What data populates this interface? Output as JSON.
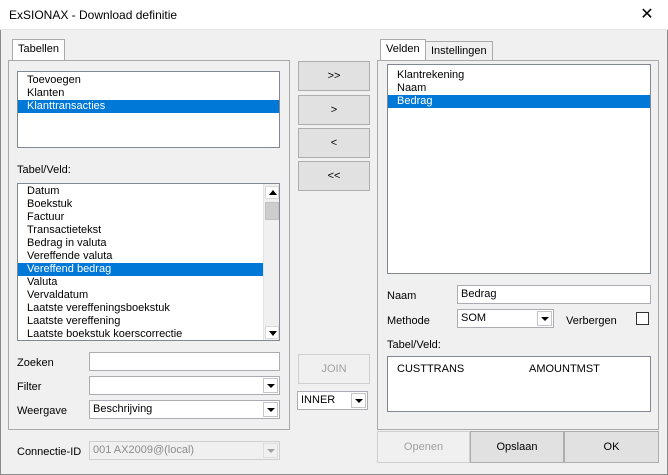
{
  "window": {
    "title": "ExSIONAX - Download definitie",
    "close_icon": "close-icon"
  },
  "left": {
    "tab_label": "Tabellen",
    "tables": [
      {
        "label": "Toevoegen",
        "selected": false
      },
      {
        "label": "Klanten",
        "selected": false
      },
      {
        "label": "Klanttransacties",
        "selected": true
      }
    ],
    "field_label": "Tabel/Veld:",
    "fields": [
      {
        "label": "Datum",
        "selected": false
      },
      {
        "label": "Boekstuk",
        "selected": false
      },
      {
        "label": "Factuur",
        "selected": false
      },
      {
        "label": "Transactietekst",
        "selected": false
      },
      {
        "label": "Bedrag in valuta",
        "selected": false
      },
      {
        "label": "Vereffende valuta",
        "selected": false
      },
      {
        "label": "Vereffend bedrag",
        "selected": true
      },
      {
        "label": "Valuta",
        "selected": false
      },
      {
        "label": "Vervaldatum",
        "selected": false
      },
      {
        "label": "Laatste vereffeningsboekstuk",
        "selected": false
      },
      {
        "label": "Laatste vereffening",
        "selected": false
      },
      {
        "label": "Laatste boekstuk koerscorrectie",
        "selected": false
      }
    ],
    "zoeken_label": "Zoeken",
    "zoeken_value": "",
    "filter_label": "Filter",
    "filter_value": "",
    "weergave_label": "Weergave",
    "weergave_value": "Beschrijving",
    "connectie_label": "Connectie-ID",
    "connectie_value": "001 AX2009@(local)"
  },
  "middle": {
    "add_all": ">>",
    "add_one": ">",
    "remove_one": "<",
    "remove_all": "<<",
    "join_label": "JOIN",
    "join_type": "INNER"
  },
  "right": {
    "tabs": [
      "Velden",
      "Instellingen"
    ],
    "fields": [
      {
        "label": "Klantrekening",
        "selected": false
      },
      {
        "label": "Naam",
        "selected": false
      },
      {
        "label": "Bedrag",
        "selected": true
      }
    ],
    "naam_label": "Naam",
    "naam_value": "Bedrag",
    "methode_label": "Methode",
    "methode_value": "SOM",
    "verbergen_label": "Verbergen",
    "tabelveld_label": "Tabel/Veld:",
    "tabelveld_table": "CUSTTRANS",
    "tabelveld_field": "AMOUNTMST"
  },
  "footer": {
    "openen": "Openen",
    "opslaan": "Opslaan",
    "ok": "OK"
  }
}
